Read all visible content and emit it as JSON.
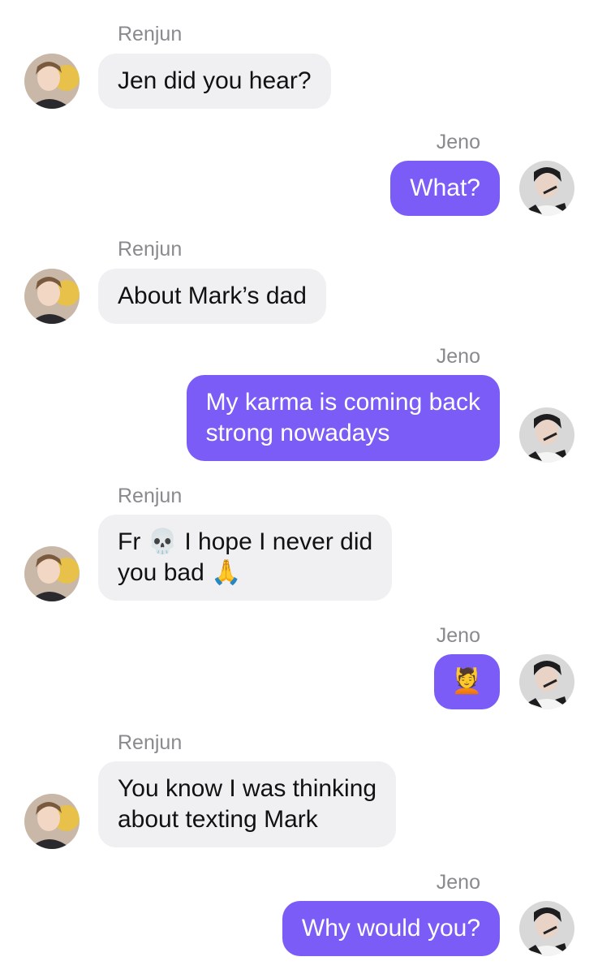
{
  "colors": {
    "outgoing_bubble": "#7b5cf6",
    "incoming_bubble": "#f0f0f2",
    "sender_name": "#8a8a8e"
  },
  "messages": [
    {
      "sender": "Renjun",
      "lines": [
        "Jen did you hear?"
      ]
    },
    {
      "sender": "Jeno",
      "lines": [
        "What?"
      ]
    },
    {
      "sender": "Renjun",
      "lines": [
        "About Mark’s dad"
      ]
    },
    {
      "sender": "Jeno",
      "lines": [
        "My karma is coming back",
        "strong nowadays"
      ]
    },
    {
      "sender": "Renjun",
      "parts": {
        "a": "Fr",
        "skull": "💀",
        "b": "I hope I never did",
        "c": "you bad",
        "pray": "🙏"
      }
    },
    {
      "sender": "Jeno",
      "emoji": "💆",
      "emoji_icon": "face-massage-icon"
    },
    {
      "sender": "Renjun",
      "lines": [
        "You know I was thinking",
        "about texting Mark"
      ]
    },
    {
      "sender": "Jeno",
      "lines": [
        "Why would you?"
      ]
    }
  ]
}
